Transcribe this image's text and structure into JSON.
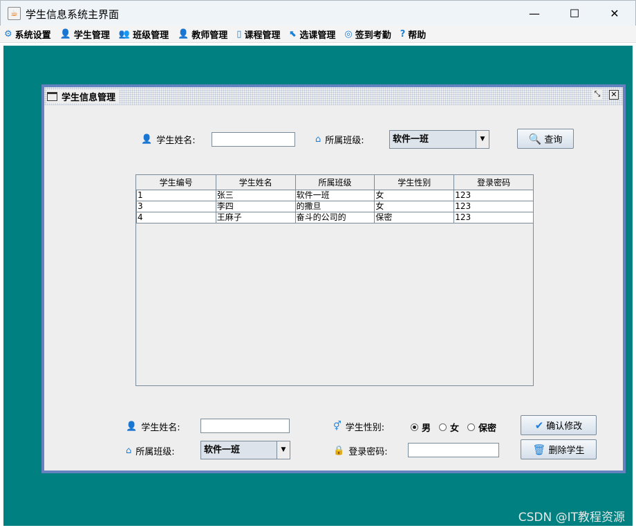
{
  "window": {
    "title": "学生信息系统主界面",
    "minimize": "—",
    "maximize": "☐",
    "close": "✕"
  },
  "menu": [
    {
      "label": "系统设置",
      "icon": "⚙"
    },
    {
      "label": "学生管理",
      "icon": "👤"
    },
    {
      "label": "班级管理",
      "icon": "👥"
    },
    {
      "label": "教师管理",
      "icon": "👤"
    },
    {
      "label": "课程管理",
      "icon": "▯"
    },
    {
      "label": "选课管理",
      "icon": "⬉"
    },
    {
      "label": "签到考勤",
      "icon": "◎"
    },
    {
      "label": "帮助",
      "icon": "?"
    }
  ],
  "internal_frame": {
    "title": "学生信息管理"
  },
  "search": {
    "name_label": "学生姓名:",
    "name_value": "",
    "class_label": "所属班级:",
    "class_value": "软件一班",
    "query_button": "查询"
  },
  "table": {
    "columns": [
      "学生编号",
      "学生姓名",
      "所属班级",
      "学生性别",
      "登录密码"
    ],
    "rows": [
      [
        "1",
        "张三",
        "软件一班",
        "女",
        "123"
      ],
      [
        "3",
        "李四",
        "的撒旦",
        "女",
        "123"
      ],
      [
        "4",
        "王麻子",
        "奋斗的公司的",
        "保密",
        "123"
      ]
    ]
  },
  "edit": {
    "name_label": "学生姓名:",
    "name_value": "",
    "class_label": "所属班级:",
    "class_value": "软件一班",
    "gender_label": "学生性别:",
    "gender_options": [
      "男",
      "女",
      "保密"
    ],
    "gender_selected": "男",
    "password_label": "登录密码:",
    "password_value": "",
    "confirm_button": "确认修改",
    "delete_button": "删除学生"
  },
  "watermark": "CSDN @IT教程资源"
}
